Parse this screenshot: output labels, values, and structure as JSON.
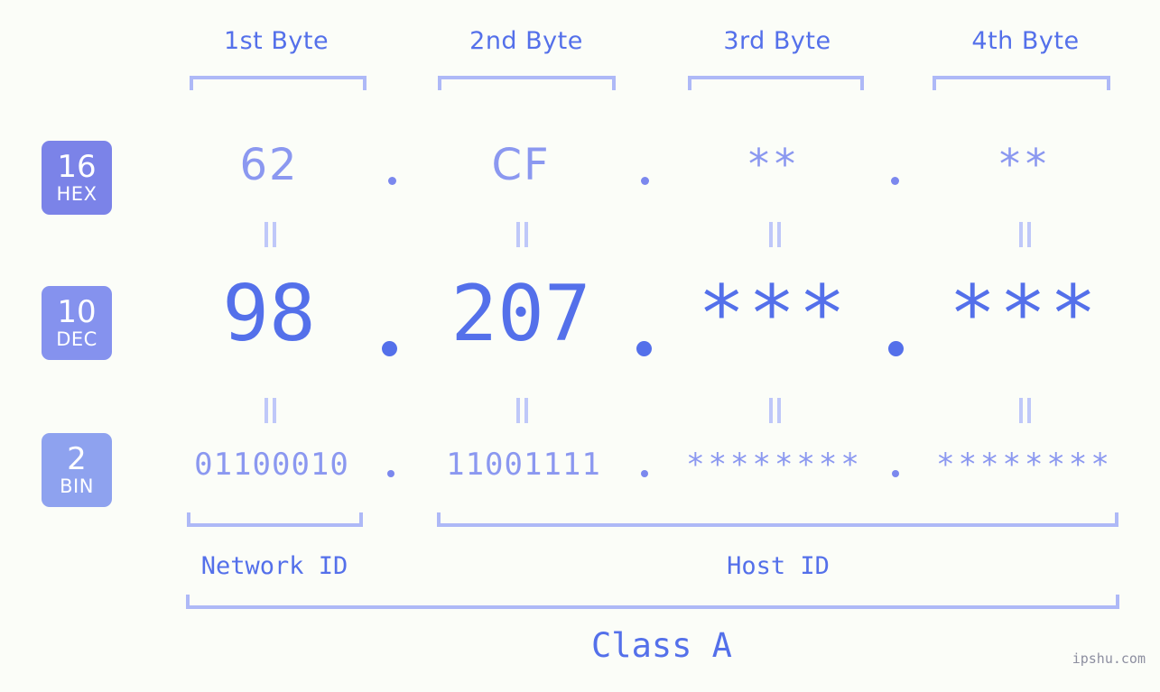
{
  "background_color": "#fbfdf8",
  "accent_color": "#5470ea",
  "accent_light_color": "#8b98f0",
  "bracket_color": "#aeb9f7",
  "byte_headers": [
    {
      "label": "1st Byte"
    },
    {
      "label": "2nd Byte"
    },
    {
      "label": "3rd Byte"
    },
    {
      "label": "4th Byte"
    }
  ],
  "bases": [
    {
      "radix": "16",
      "name": "HEX",
      "color": "#7b83e8"
    },
    {
      "radix": "10",
      "name": "DEC",
      "color": "#8592ee"
    },
    {
      "radix": "2",
      "name": "BIN",
      "color": "#8ea2ef"
    }
  ],
  "rows": {
    "hex": {
      "base_label": "16",
      "base_name": "HEX",
      "values": [
        "62",
        "CF",
        "**",
        "**"
      ],
      "separators": [
        ".",
        ".",
        "."
      ]
    },
    "dec": {
      "base_label": "10",
      "base_name": "DEC",
      "values": [
        "98",
        "207",
        "***",
        "***"
      ],
      "separators": [
        ".",
        ".",
        "."
      ]
    },
    "bin": {
      "base_label": "2",
      "base_name": "BIN",
      "values": [
        "01100010",
        "11001111",
        "********",
        "********"
      ],
      "separators": [
        ".",
        ".",
        "."
      ]
    }
  },
  "connectors": {
    "symbol": "=",
    "count_per_row": 4
  },
  "sections": [
    {
      "label": "Network ID",
      "spans_bytes": "1"
    },
    {
      "label": "Host ID",
      "spans_bytes": "2-4"
    }
  ],
  "class": {
    "label": "Class A"
  },
  "watermark": {
    "text": "ipshu.com"
  }
}
